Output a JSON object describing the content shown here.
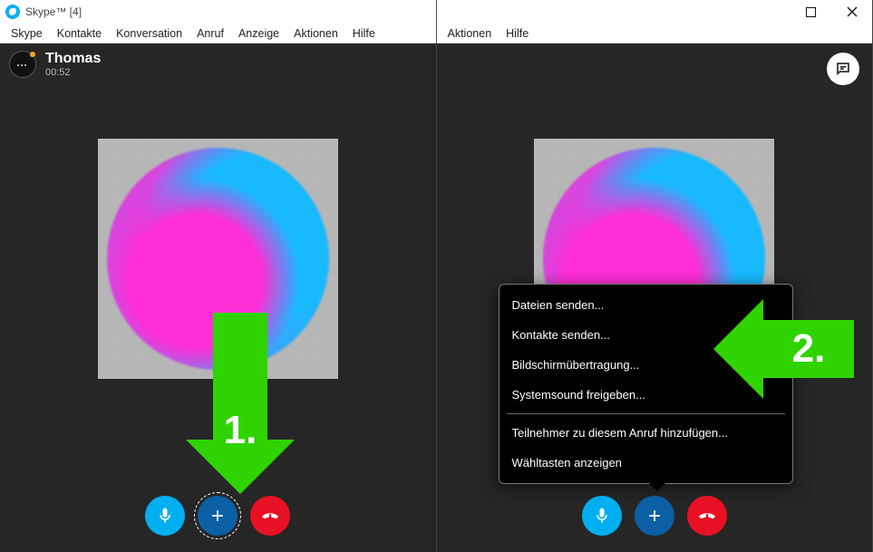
{
  "window": {
    "title": "Skype™ [4]"
  },
  "menu": [
    "Skype",
    "Kontakte",
    "Konversation",
    "Anruf",
    "Anzeige",
    "Aktionen",
    "Hilfe"
  ],
  "menu_right": [
    "Aktionen",
    "Hilfe"
  ],
  "call": {
    "name": "Thomas",
    "duration": "00:52"
  },
  "popup": {
    "section1": [
      "Dateien senden...",
      "Kontakte senden...",
      "Bildschirmübertragung...",
      "Systemsound freigeben..."
    ],
    "section2": [
      "Teilnehmer zu diesem Anruf hinzufügen...",
      "Wähltasten anzeigen"
    ]
  },
  "annotations": {
    "step1": "1.",
    "step2": "2."
  },
  "colors": {
    "skype_blue": "#00aff0",
    "plus_blue": "#0b5fa5",
    "hang_red": "#e81123",
    "accent_green": "#2fd300"
  }
}
